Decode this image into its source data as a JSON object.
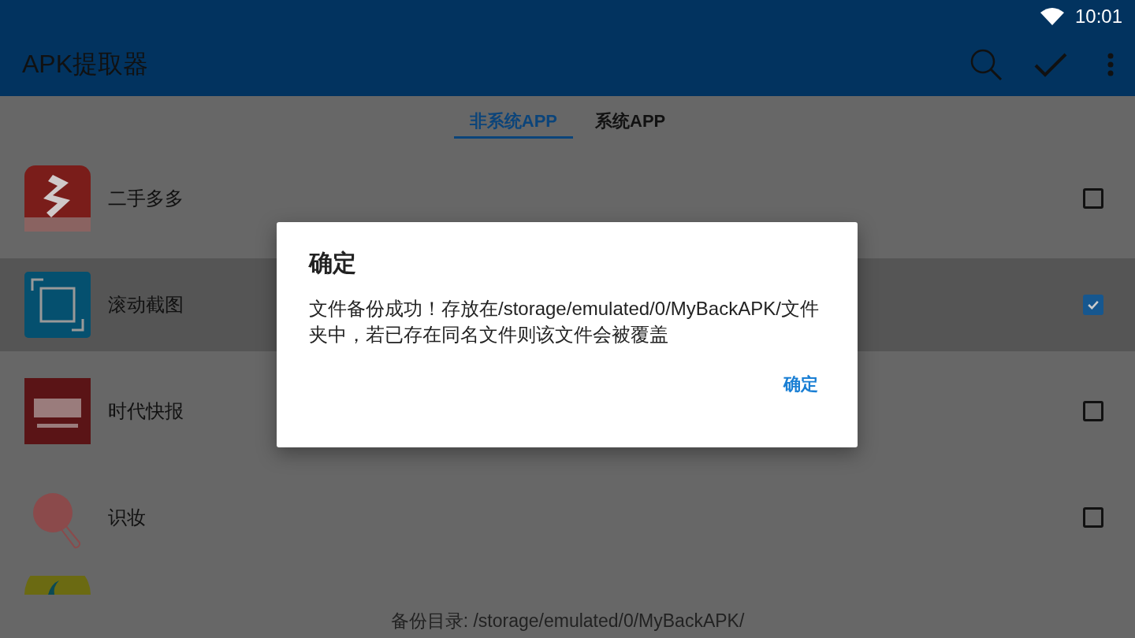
{
  "status_bar": {
    "time": "10:01"
  },
  "toolbar": {
    "title": "APK提取器"
  },
  "tabs": [
    {
      "label": "非系统APP",
      "selected": true
    },
    {
      "label": "系统APP",
      "selected": false
    }
  ],
  "apps": [
    {
      "name": "二手多多",
      "selected": false,
      "checked": false
    },
    {
      "name": "滚动截图",
      "selected": true,
      "checked": true
    },
    {
      "name": "时代快报",
      "selected": false,
      "checked": false
    },
    {
      "name": "识妆",
      "selected": false,
      "checked": false
    }
  ],
  "footer": "备份目录: /storage/emulated/0/MyBackAPK/",
  "dialog": {
    "title": "确定",
    "message": "文件备份成功！存放在/storage/emulated/0/MyBackAPK/文件夹中，若已存在同名文件则该文件会被覆盖",
    "button": "确定"
  }
}
